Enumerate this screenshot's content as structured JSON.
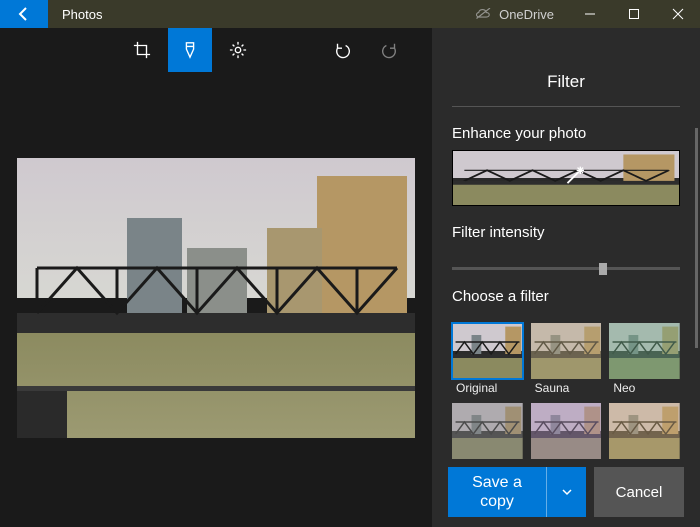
{
  "titlebar": {
    "app_title": "Photos",
    "onedrive_label": "OneDrive"
  },
  "toolbar": {
    "crop": "crop",
    "brush": "brush",
    "adjust": "adjust",
    "undo": "undo",
    "redo": "redo"
  },
  "sidebar": {
    "title": "Filter",
    "enhance_label": "Enhance your photo",
    "intensity_label": "Filter intensity",
    "choose_label": "Choose a filter",
    "filters": [
      {
        "name": "Original",
        "selected": true,
        "tint": "none"
      },
      {
        "name": "Sauna",
        "selected": false,
        "tint": "#b7a77d"
      },
      {
        "name": "Neo",
        "selected": false,
        "tint": "#6fa986"
      },
      {
        "name": "",
        "selected": false,
        "tint": "#888888"
      },
      {
        "name": "",
        "selected": false,
        "tint": "#a98bb5"
      },
      {
        "name": "",
        "selected": false,
        "tint": "#c9a877"
      }
    ]
  },
  "actions": {
    "save_label": "Save a copy",
    "cancel_label": "Cancel"
  },
  "colors": {
    "accent": "#0078d7",
    "panel": "#2b2b2b",
    "bg": "#1a1a1a"
  }
}
